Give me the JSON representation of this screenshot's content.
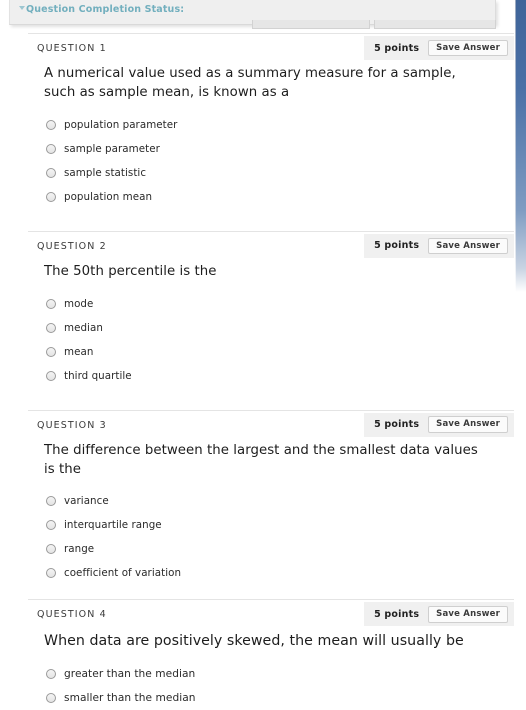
{
  "top_bar": {
    "status_label": "Question Completion Status:",
    "caret_icon": "chevron-down-icon",
    "accent_color": "#72afbe",
    "background_color": "#efefef"
  },
  "scrollbar": {
    "name": "vertical-scrollbar",
    "thumb_color": "#3f6499"
  },
  "questions": [
    {
      "number_label": "QUESTION 1",
      "points_label": "5 points",
      "save_label": "Save Answer",
      "text": "A numerical value used as a summary measure for a sample, such as sample mean, is known as a",
      "options": [
        "population parameter",
        "sample parameter",
        "sample statistic",
        "population mean"
      ]
    },
    {
      "number_label": "QUESTION 2",
      "points_label": "5 points",
      "save_label": "Save Answer",
      "text": "The 50th percentile is the",
      "options": [
        "mode",
        "median",
        "mean",
        "third quartile"
      ]
    },
    {
      "number_label": "QUESTION 3",
      "points_label": "5 points",
      "save_label": "Save Answer",
      "text": "The difference between the largest and the smallest data values is the",
      "options": [
        "variance",
        "interquartile range",
        "range",
        "coefficient of variation"
      ]
    },
    {
      "number_label": "QUESTION 4",
      "points_label": "5 points",
      "save_label": "Save Answer",
      "text": "When data are positively skewed, the mean will usually be",
      "options": [
        "greater than the median",
        "smaller than the median"
      ]
    }
  ]
}
